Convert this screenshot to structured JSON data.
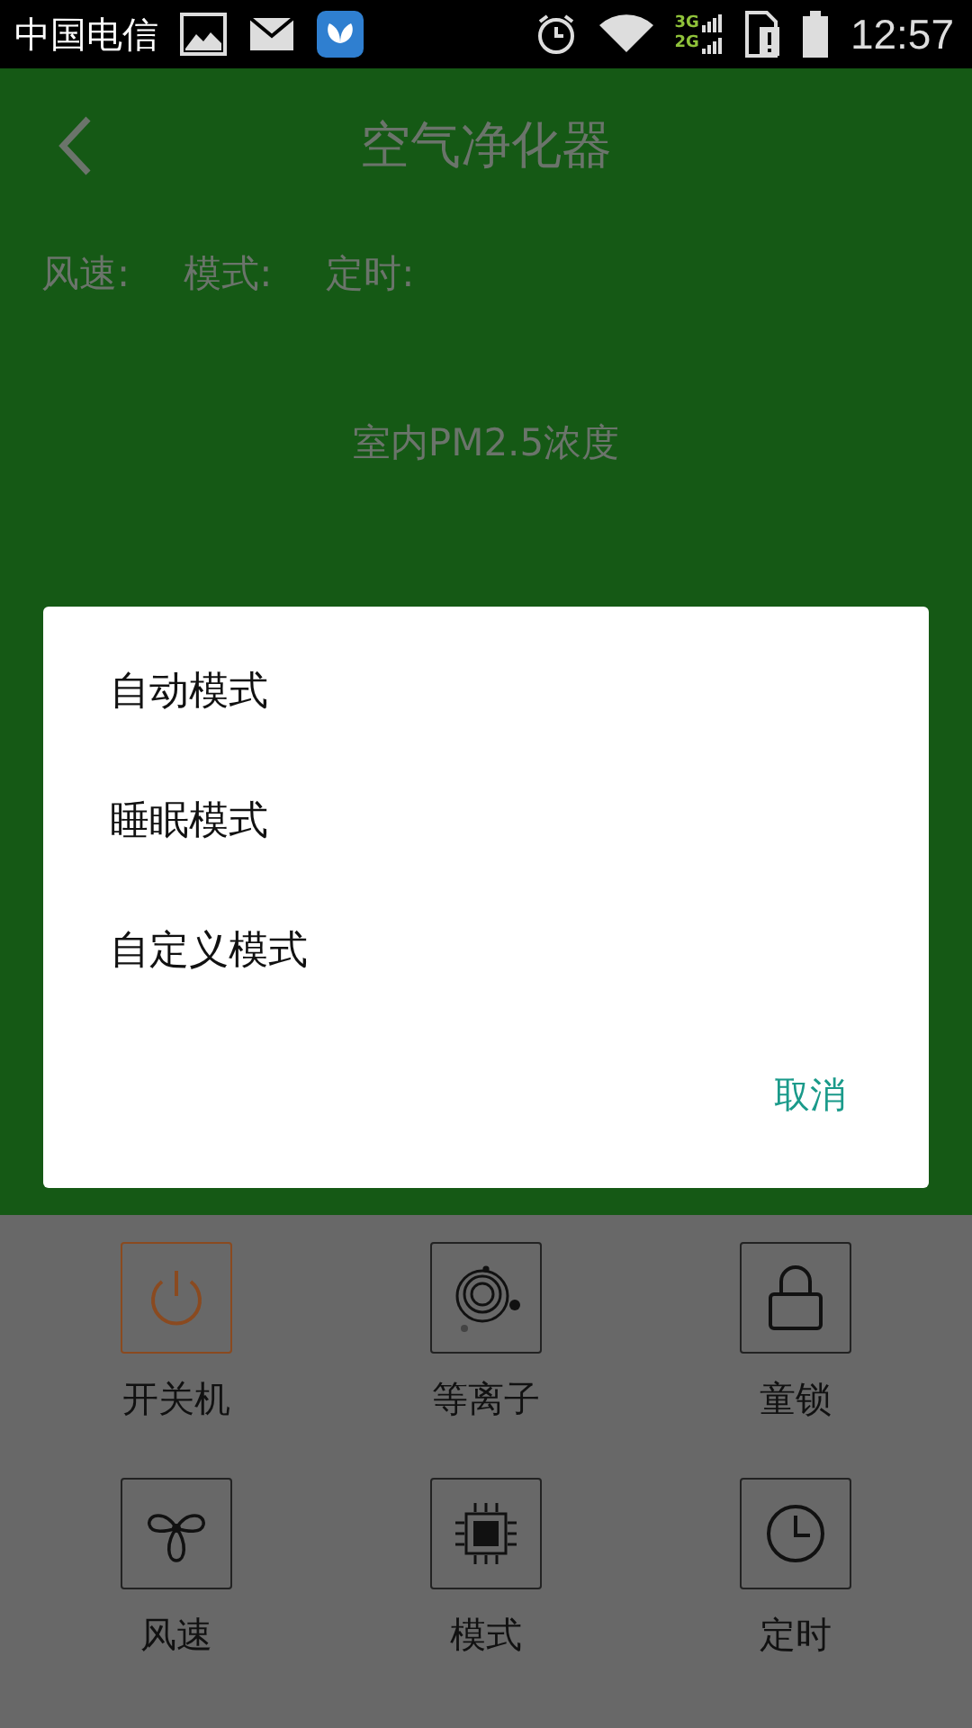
{
  "status_bar": {
    "carrier": "中国电信",
    "network_top": "3G",
    "network_bottom": "2G",
    "time": "12:57"
  },
  "header": {
    "title": "空气净化器"
  },
  "info": [
    "风速:",
    "模式:",
    "定时:"
  ],
  "pm": {
    "label": "室内PM2.5浓度"
  },
  "controls": [
    {
      "label": "开关机",
      "kind": "power",
      "on": true
    },
    {
      "label": "等离子",
      "kind": "plasma",
      "on": false
    },
    {
      "label": "童锁",
      "kind": "lock",
      "on": false
    },
    {
      "label": "风速",
      "kind": "fan",
      "on": false
    },
    {
      "label": "模式",
      "kind": "chip",
      "on": false
    },
    {
      "label": "定时",
      "kind": "clock",
      "on": false
    }
  ],
  "dialog": {
    "options": [
      "自动模式",
      "睡眠模式",
      "自定义模式"
    ],
    "cancel": "取消"
  }
}
